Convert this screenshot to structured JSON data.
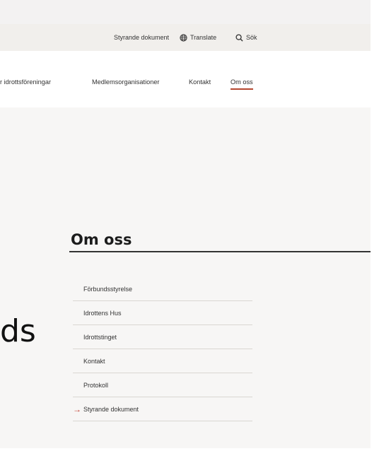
{
  "utility_bar": {
    "governing_docs": "Styrande dokument",
    "translate": "Translate",
    "search": "Sök"
  },
  "main_nav": {
    "items": [
      {
        "label": "r idrottsföreningar"
      },
      {
        "label": "Medlemsorganisationer"
      },
      {
        "label": "Kontakt"
      },
      {
        "label": "Om oss",
        "active": true
      }
    ]
  },
  "page": {
    "partial_heading": "ds",
    "section_title": "Om oss"
  },
  "side_menu": {
    "items": [
      {
        "label": "Förbundsstyrelse"
      },
      {
        "label": "Idrottens Hus"
      },
      {
        "label": "Idrottstinget"
      },
      {
        "label": "Kontakt"
      },
      {
        "label": "Protokoll"
      },
      {
        "label": "Styrande dokument",
        "current": true
      }
    ]
  },
  "colors": {
    "accent": "#b5472f",
    "arrow": "#c0392b",
    "utility_bg": "#f1efec",
    "content_bg": "#f7f6f5"
  },
  "icons": {
    "translate": "globe-icon",
    "search": "search-icon",
    "current_item": "arrow-right-icon"
  }
}
